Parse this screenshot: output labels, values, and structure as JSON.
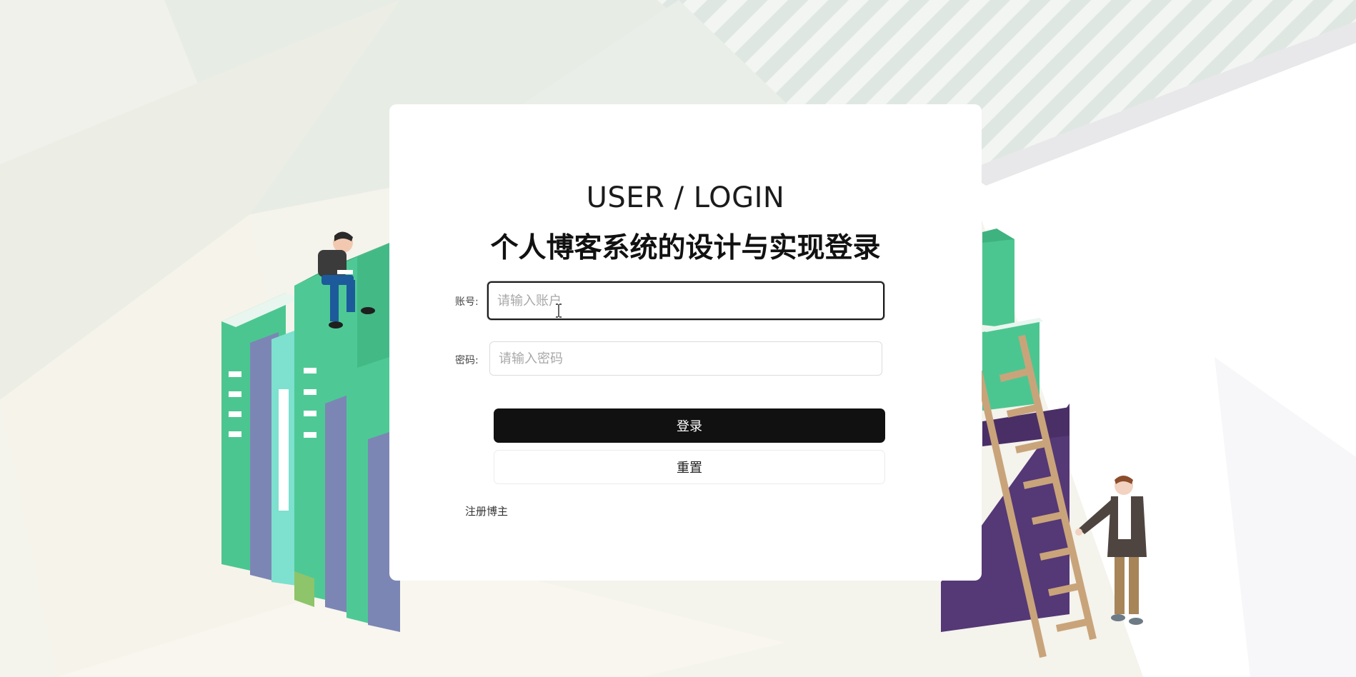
{
  "login": {
    "title_en": "USER / LOGIN",
    "title_cn": "个人博客系统的设计与实现登录",
    "account_label": "账号:",
    "account_placeholder": "请输入账户",
    "password_label": "密码:",
    "password_placeholder": "请输入密码",
    "login_button": "登录",
    "reset_button": "重置",
    "register_link": "注册博主"
  },
  "colors": {
    "primary_button": "#111111",
    "book_green": "#4cc690",
    "book_purple": "#7c86b4",
    "box_purple": "#553876"
  },
  "illustration": {
    "left": "books-with-reading-person",
    "right": "ladder-with-standing-person"
  }
}
